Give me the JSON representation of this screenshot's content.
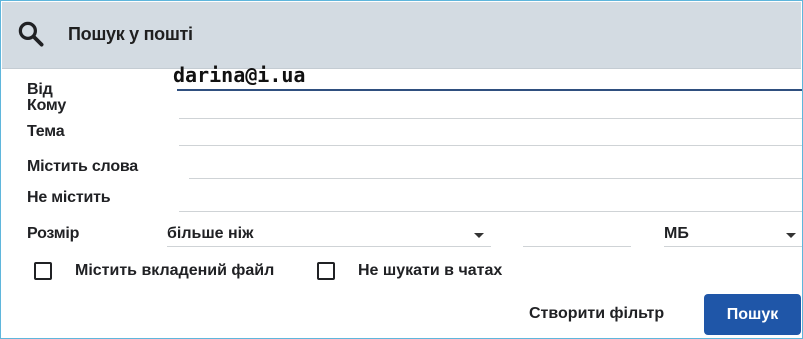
{
  "search_bar": {
    "title": "Пошук у пошті",
    "icon": "search-icon"
  },
  "fields": {
    "from": {
      "label": "Від",
      "value": "darina@i.ua"
    },
    "to": {
      "label": "Кому",
      "value": ""
    },
    "subject": {
      "label": "Тема",
      "value": ""
    },
    "has_words": {
      "label": "Містить слова",
      "value": ""
    },
    "doesnt_have": {
      "label": "Не містить",
      "value": ""
    }
  },
  "size": {
    "label": "Розмір",
    "comparator": "більше ніж",
    "value": "",
    "unit": "МБ"
  },
  "checkboxes": {
    "has_attachment": {
      "label": "Містить вкладений файл",
      "checked": false
    },
    "exclude_chats": {
      "label": "Не шукати в чатах",
      "checked": false
    }
  },
  "actions": {
    "create_filter": "Створити фільтр",
    "search": "Пошук"
  },
  "colors": {
    "header_bg": "#d3dbe2",
    "primary_button": "#1f56a8",
    "frame_border": "#5fb6dc"
  }
}
